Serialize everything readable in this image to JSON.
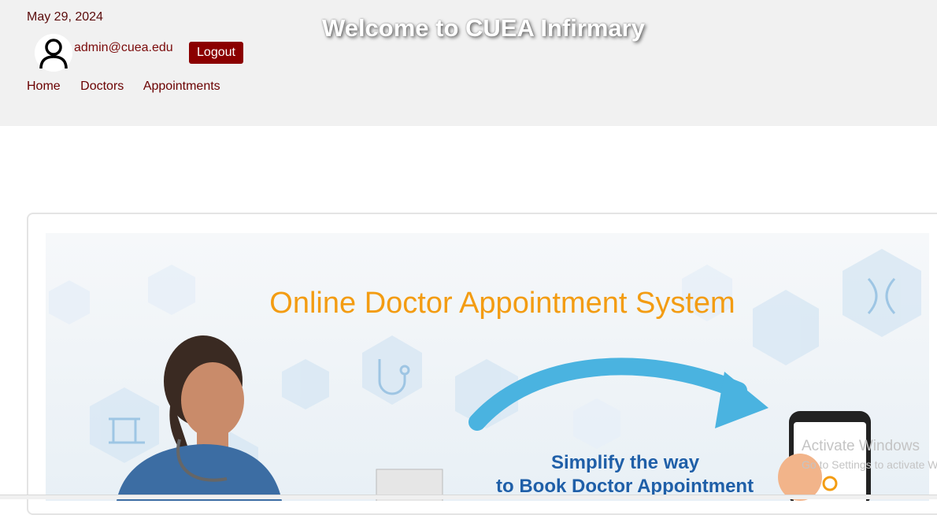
{
  "header": {
    "date": "May 29, 2024",
    "user_email": "admin@cuea.edu",
    "logout_label": "Logout",
    "welcome": "Welcome to CUEA Infirmary"
  },
  "nav": {
    "items": [
      {
        "label": "Home"
      },
      {
        "label": "Doctors"
      },
      {
        "label": "Appointments"
      }
    ]
  },
  "banner": {
    "title": "Online Doctor Appointment System",
    "subtitle_line1": "Simplify the way",
    "subtitle_line2": "to Book Doctor Appointment"
  },
  "watermark": {
    "title": "Activate Windows",
    "subtitle": "Go to Settings to activate Windows."
  },
  "colors": {
    "header_bg": "#f1f1f1",
    "accent": "#8b0000",
    "nav_text": "#6a0000",
    "banner_title": "#f39c12",
    "banner_subtitle": "#1f5fa8",
    "arrow": "#4ab3e0"
  },
  "icons": {
    "avatar": "user-avatar-icon",
    "banner_hexagons": "medical-hexagon-icons",
    "arrow": "curved-arrow-icon",
    "phone": "smartphone-icon"
  }
}
